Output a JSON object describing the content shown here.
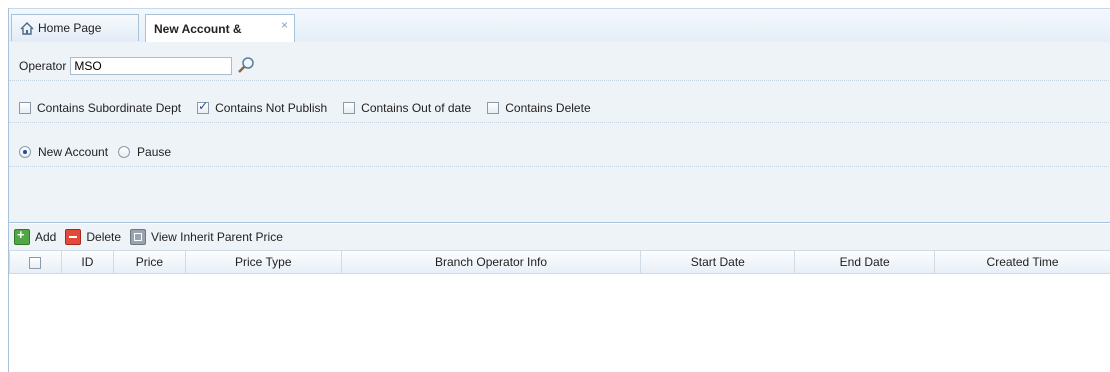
{
  "tabs": [
    {
      "label": "Home Page",
      "icon": "home-icon"
    },
    {
      "label": "New Account &",
      "icon": "close-icon",
      "close_glyph": "×"
    }
  ],
  "operator": {
    "label": "Operator",
    "value": "MSO",
    "icon": "search-icon"
  },
  "checkboxes": [
    {
      "label": "Contains Subordinate Dept",
      "checked": false
    },
    {
      "label": "Contains Not Publish",
      "checked": true
    },
    {
      "label": "Contains Out of date",
      "checked": false
    },
    {
      "label": "Contains Delete",
      "checked": false
    }
  ],
  "radios": [
    {
      "label": "New Account",
      "selected": true
    },
    {
      "label": "Pause",
      "selected": false
    }
  ],
  "toolbar": {
    "add_label": "Add",
    "delete_label": "Delete",
    "view_inherit_label": "View Inherit Parent Price"
  },
  "grid": {
    "columns": [
      "ID",
      "Price",
      "Price Type",
      "Branch Operator Info",
      "Start Date",
      "End Date",
      "Created Time"
    ],
    "rows": []
  },
  "colors": {
    "accent": "#a9c2dc",
    "panel_bg": "#eef3f8",
    "check_blue": "#1b4f99"
  }
}
